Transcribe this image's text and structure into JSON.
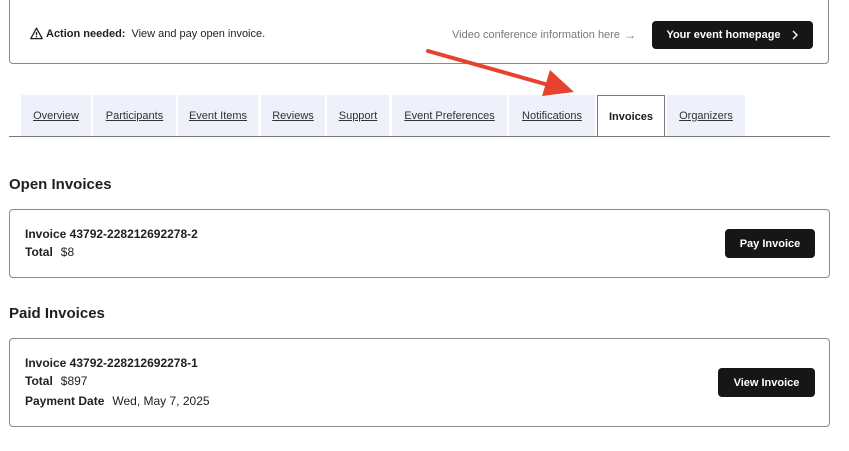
{
  "banner": {
    "action_label": "Action needed:",
    "action_text": "View and pay open invoice.",
    "video_link": "Video conference information here",
    "video_arrow": "→",
    "home_button": "Your event homepage"
  },
  "tabs": [
    {
      "label": "Overview"
    },
    {
      "label": "Participants"
    },
    {
      "label": "Event Items"
    },
    {
      "label": "Reviews"
    },
    {
      "label": "Support"
    },
    {
      "label": "Event Preferences"
    },
    {
      "label": "Notifications"
    },
    {
      "label": "Invoices",
      "active": true
    },
    {
      "label": "Organizers"
    }
  ],
  "open_invoices": {
    "heading": "Open Invoices",
    "invoice_title": "Invoice 43792-228212692278-2",
    "total_label": "Total",
    "total_value": "$8",
    "button": "Pay Invoice"
  },
  "paid_invoices": {
    "heading": "Paid Invoices",
    "invoice_title": "Invoice 43792-228212692278-1",
    "total_label": "Total",
    "total_value": "$897",
    "payment_date_label": "Payment Date",
    "payment_date_value": "Wed, May 7, 2025",
    "button": "View Invoice"
  },
  "colors": {
    "dark_button": "#161616",
    "tab_background": "#eef0fa",
    "annotation_arrow": "#e5432f"
  },
  "icons": {
    "warning": "warning-triangle-icon",
    "home_chevron": "chevron-right-icon",
    "annotation": "red-arrow-annotation"
  }
}
